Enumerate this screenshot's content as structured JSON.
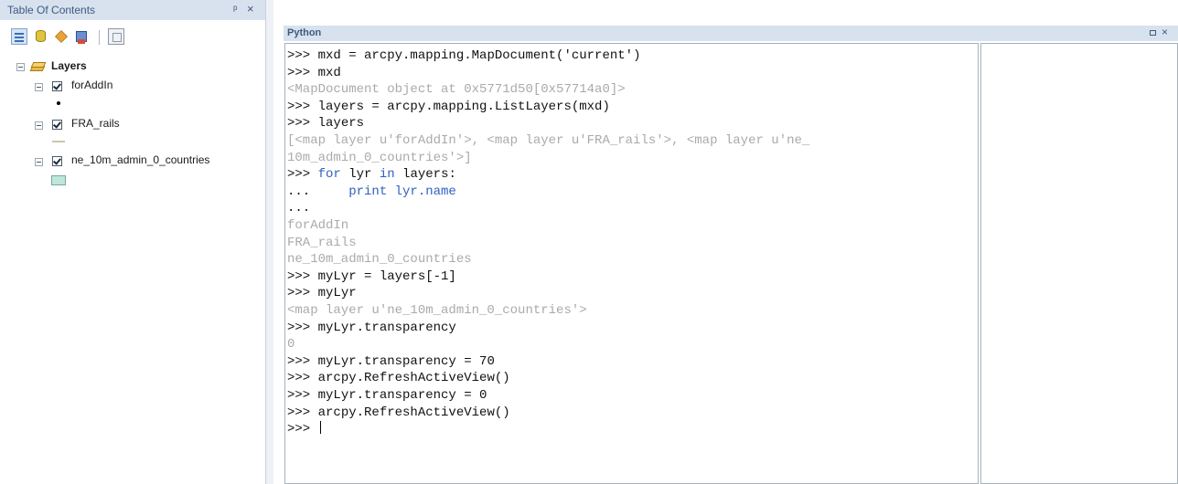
{
  "toc": {
    "title": "Table Of Contents",
    "pin_glyph": "ᵖ",
    "close_glyph": "×",
    "toolbar": [
      "list-by-drawing-order-icon",
      "list-by-source-icon",
      "list-by-visibility-icon",
      "list-by-selection-icon",
      "options-icon"
    ],
    "tree": {
      "root_label": "Layers",
      "layers": [
        {
          "label": "forAddIn",
          "checked": true,
          "symbol": "point"
        },
        {
          "label": "FRA_rails",
          "checked": true,
          "symbol": "line"
        },
        {
          "label": "ne_10m_admin_0_countries",
          "checked": true,
          "symbol": "polygon"
        }
      ]
    }
  },
  "python": {
    "title": "Python",
    "close_glyph": "×",
    "lines": [
      {
        "t": "cmd",
        "p": ">>> ",
        "c": "mxd = arcpy.mapping.MapDocument('current')"
      },
      {
        "t": "cmd",
        "p": ">>> ",
        "c": "mxd"
      },
      {
        "t": "out",
        "c": "<MapDocument object at 0x5771d50[0x57714a0]>"
      },
      {
        "t": "cmd",
        "p": ">>> ",
        "c": "layers = arcpy.mapping.ListLayers(mxd)"
      },
      {
        "t": "cmd",
        "p": ">>> ",
        "c": "layers"
      },
      {
        "t": "out",
        "c": "[<map layer u'forAddIn'>, <map layer u'FRA_rails'>, <map layer u'ne_"
      },
      {
        "t": "out",
        "c": "10m_admin_0_countries'>]"
      },
      {
        "t": "cmd",
        "p": ">>> ",
        "kw1": "for",
        "c1": " lyr ",
        "kw2": "in",
        "c": " layers:"
      },
      {
        "t": "cmd",
        "p": "...     ",
        "c": "print lyr.name",
        "kw1": "",
        "c1": "",
        "kw2": ""
      },
      {
        "t": "cmd",
        "p": "...",
        "c": ""
      },
      {
        "t": "out",
        "c": "forAddIn"
      },
      {
        "t": "out",
        "c": "FRA_rails"
      },
      {
        "t": "out",
        "c": "ne_10m_admin_0_countries"
      },
      {
        "t": "cmd",
        "p": ">>> ",
        "c": "myLyr = layers[-1]"
      },
      {
        "t": "cmd",
        "p": ">>> ",
        "c": "myLyr"
      },
      {
        "t": "out",
        "c": "<map layer u'ne_10m_admin_0_countries'>"
      },
      {
        "t": "cmd",
        "p": ">>> ",
        "c": "myLyr.transparency"
      },
      {
        "t": "out",
        "c": "0"
      },
      {
        "t": "cmd",
        "p": ">>> ",
        "c": "myLyr.transparency = 70"
      },
      {
        "t": "cmd",
        "p": ">>> ",
        "c": "arcpy.RefreshActiveView()"
      },
      {
        "t": "cmd",
        "p": ">>> ",
        "c": "myLyr.transparency = 0"
      },
      {
        "t": "cmd",
        "p": ">>> ",
        "c": "arcpy.RefreshActiveView()"
      },
      {
        "t": "cmd",
        "p": ">>> ",
        "c": ""
      }
    ]
  },
  "colors": {
    "titlebar_bg": "#d8e2ef",
    "output_text": "#aaaaaa",
    "keyword": "#3060c0"
  }
}
